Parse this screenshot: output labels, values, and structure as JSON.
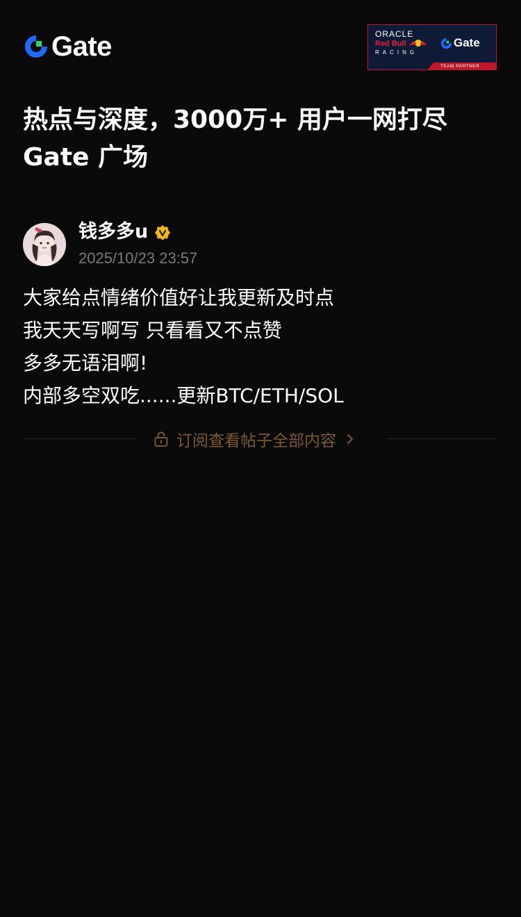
{
  "brand": {
    "name": "Gate",
    "accent_blue": "#1f6bff",
    "accent_green": "#2bd67b"
  },
  "partner_badge": {
    "line1": "ORACLE",
    "line2": "Red Bull",
    "line3": "RACING",
    "brand": "Gate",
    "footer": "TEAM PARTNER"
  },
  "headline": {
    "line1": "热点与深度，3000万+ 用户一网打尽",
    "line2": "Gate 广场"
  },
  "post": {
    "author": "钱多多u",
    "verified_icon": "verified-badge-icon",
    "time": "2025/10/23 23:57",
    "lines": [
      "大家给点情绪价值好让我更新及时点",
      "我天天写啊写 只看看又不点赞",
      "多多无语泪啊!",
      "内部多空双吃......更新BTC/ETH/SOL"
    ]
  },
  "paywall": {
    "label": "订阅查看帖子全部内容",
    "icon": "lock-icon",
    "color": "#7a5a2c"
  }
}
